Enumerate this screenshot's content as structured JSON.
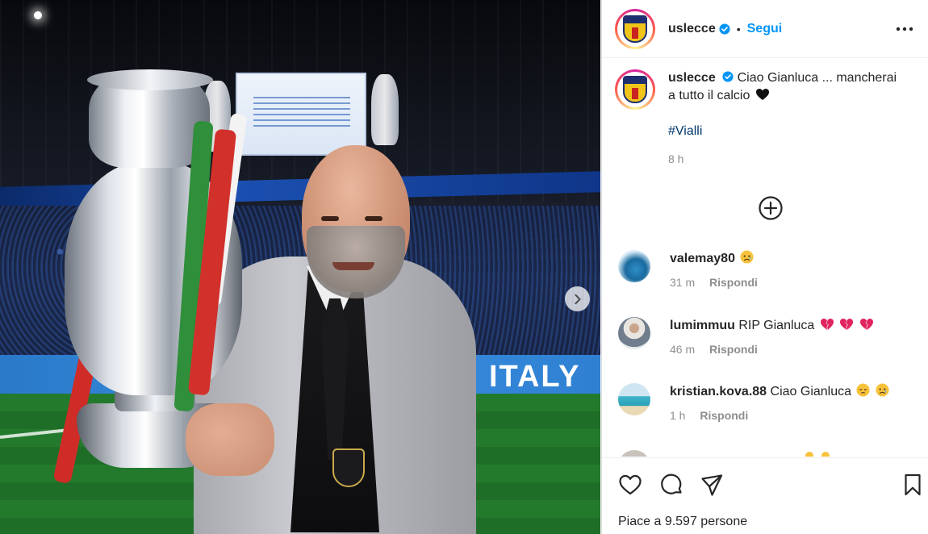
{
  "post": {
    "username": "uslecce",
    "follow_label": "Segui",
    "separator": "•",
    "caption": {
      "username": "uslecce",
      "text": "Ciao Gianluca ... mancherai a tutto il calcio",
      "hashtag": "#Vialli",
      "time": "8 h"
    },
    "likes_text": "Piace a 9.597 persone"
  },
  "photo": {
    "ad_board_text": "ITALY"
  },
  "comments": [
    {
      "username": "valemay80",
      "text": "",
      "emojis": [
        "sad-face"
      ],
      "time": "31 m",
      "reply_label": "Rispondi"
    },
    {
      "username": "lumimmuu",
      "text": "RIP Gianluca",
      "emojis": [
        "broken-heart",
        "broken-heart",
        "broken-heart"
      ],
      "time": "46 m",
      "reply_label": "Rispondi"
    },
    {
      "username": "kristian.kova.88",
      "text": "Ciao Gianluca",
      "emojis": [
        "pensive-face",
        "sad-face"
      ],
      "time": "1 h",
      "reply_label": "Rispondi"
    }
  ],
  "colors": {
    "accent": "#0095f6",
    "hashtag": "#00376b",
    "muted": "#8e8e8e",
    "text": "#262626"
  },
  "icons": [
    "verified-badge-icon",
    "more-options-icon",
    "add-comments-icon",
    "next-arrow-icon",
    "heart-icon",
    "comment-icon",
    "share-icon",
    "bookmark-icon"
  ]
}
